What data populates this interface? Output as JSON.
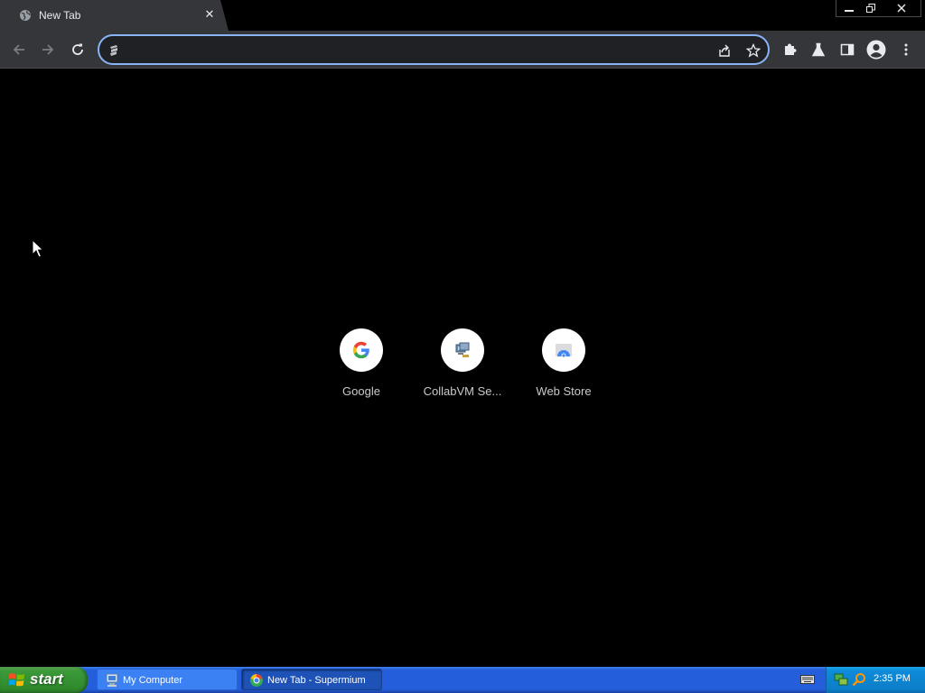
{
  "browser": {
    "tab": {
      "title": "New Tab",
      "close_glyph": "✕",
      "favicon": "globe-icon"
    },
    "window_controls": {
      "minimize": "minimize-icon",
      "restore": "restore-icon",
      "close": "close-icon"
    },
    "toolbar": {
      "back": "back-arrow-icon",
      "forward": "forward-arrow-icon",
      "reload": "reload-icon",
      "omnibox": {
        "value": "",
        "placeholder": "",
        "leading_icon": "site-info-icon"
      },
      "omnibox_actions": [
        "share-icon",
        "bookmark-star-icon"
      ],
      "extensions": [
        "extensions-puzzle-icon",
        "labs-flask-icon",
        "side-panel-icon",
        "profile-avatar-icon",
        "kebab-menu-icon"
      ]
    }
  },
  "ntp": {
    "shortcuts": [
      {
        "label": "Google",
        "icon": "google-g-icon"
      },
      {
        "label": "CollabVM Se...",
        "icon": "collabvm-icon"
      },
      {
        "label": "Web Store",
        "icon": "web-store-icon"
      }
    ]
  },
  "taskbar": {
    "start_label": "start",
    "tasks": [
      {
        "label": "My Computer",
        "icon": "my-computer-icon",
        "active": false
      },
      {
        "label": "New Tab - Supermium",
        "icon": "supermium-icon",
        "active": true
      }
    ],
    "tray": {
      "clock": "2:35 PM",
      "icons": [
        "keyboard-icon",
        "network-icon",
        "search-icon"
      ]
    }
  },
  "colors": {
    "tab_active": "#35363a",
    "toolbar": "#35363a",
    "omnibox_focus": "#8ab4f8",
    "ntp_background": "#000000",
    "taskbar_blue": "#245edb",
    "start_green": "#3c9a3b"
  }
}
